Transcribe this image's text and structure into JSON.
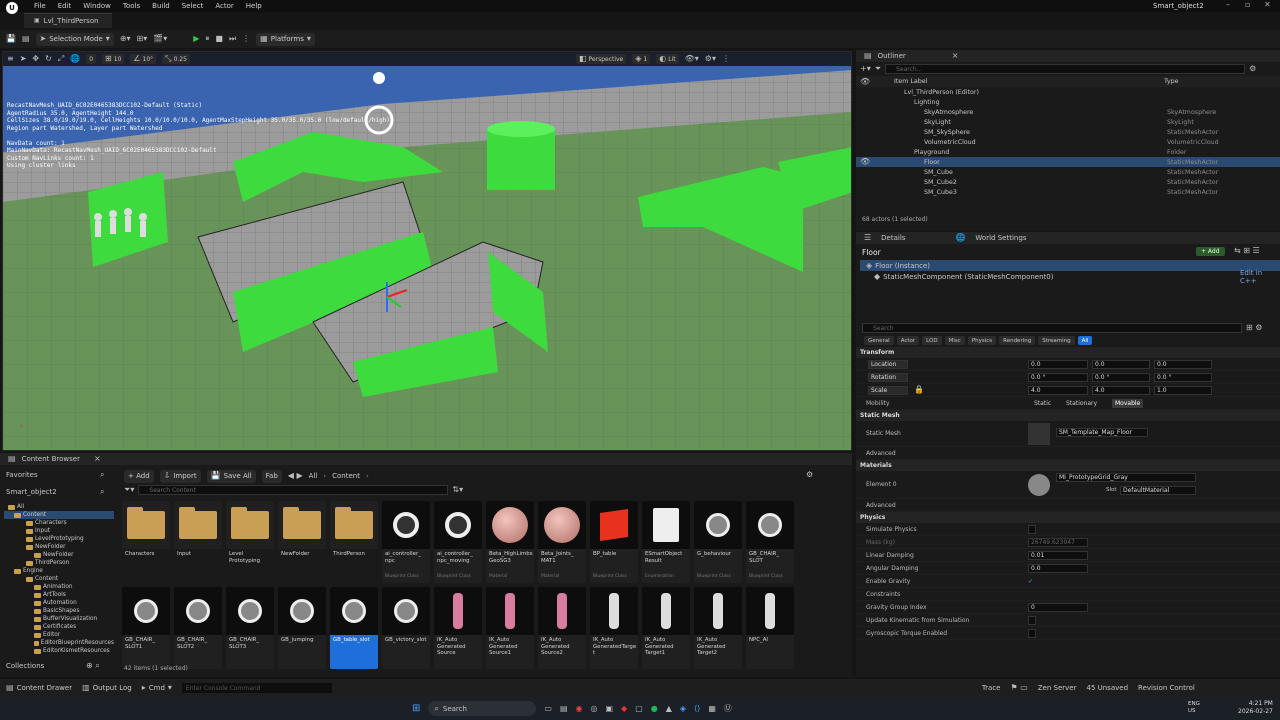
{
  "app": {
    "menus": [
      "File",
      "Edit",
      "Window",
      "Tools",
      "Build",
      "Select",
      "Actor",
      "Help"
    ],
    "project": "Smart_object2",
    "level_tab": "Lvl_ThirdPerson"
  },
  "toolbar": {
    "selection_mode": "Selection Mode",
    "platforms": "Platforms"
  },
  "viewport": {
    "perspective": "Perspective",
    "lit": "Lit",
    "grid_snap": "10",
    "rot_snap": "10°",
    "scale_snap": "0.25",
    "cam_speed": "1",
    "snap0": "0",
    "nav_text": "RecastNavMesh_UAID_6C02E0465383DCC102-Default (Static)\nAgentRadius 35.0, AgentHeight 144.0\nCellSizes 38.0/19.0/19.0, CellHeights 10.0/10.0/10.0, AgentMaxStepHeight 35.0/35.0/35.0 (low/default/high)\nRegion part Watershed, Layer part Watershed\n\nNavData count: 1\nMainNavData: RecastNavMesh_UAID_6C02E0465383DCC102-Default\nCustom NavLinks count: 1\nUsing cluster links"
  },
  "outliner": {
    "title": "Outliner",
    "search_placeholder": "Search...",
    "col_label": "Item Label",
    "col_type": "Type",
    "status": "68 actors (1 selected)",
    "rows": [
      {
        "label": "Lvl_ThirdPerson (Editor)",
        "type": "",
        "indent": 48
      },
      {
        "label": "Lighting",
        "type": "",
        "indent": 58
      },
      {
        "label": "SkyAtmosphere",
        "type": "SkyAtmosphere",
        "indent": 68
      },
      {
        "label": "SkyLight",
        "type": "SkyLight",
        "indent": 68
      },
      {
        "label": "SM_SkySphere",
        "type": "StaticMeshActor",
        "indent": 68
      },
      {
        "label": "VolumetricCloud",
        "type": "VolumetricCloud",
        "indent": 68
      },
      {
        "label": "Playground",
        "type": "Folder",
        "indent": 58
      },
      {
        "label": "Floor",
        "type": "StaticMeshActor",
        "indent": 68
      },
      {
        "label": "SM_Cube",
        "type": "StaticMeshActor",
        "indent": 68
      },
      {
        "label": "SM_Cube2",
        "type": "StaticMeshActor",
        "indent": 68
      },
      {
        "label": "SM_Cube3",
        "type": "StaticMeshActor",
        "indent": 68
      }
    ]
  },
  "details": {
    "tab1": "Details",
    "tab2": "World Settings",
    "actor": "Floor",
    "add": "+ Add",
    "instance": "Floor (Instance)",
    "component": "StaticMeshComponent (StaticMeshComponent0)",
    "edit_cpp": "Edit in C++",
    "search_placeholder": "Search",
    "filters": [
      "General",
      "Actor",
      "LOD",
      "Misc",
      "Physics",
      "Rendering",
      "Streaming",
      "All"
    ],
    "transform": "Transform",
    "location": "Location",
    "rotation": "Rotation",
    "scale": "Scale",
    "loc": [
      "0.0",
      "0.0",
      "0.0"
    ],
    "rot": [
      "0.0 °",
      "0.0 °",
      "0.0 °"
    ],
    "scl": [
      "4.0",
      "4.0",
      "1.0"
    ],
    "mobility": "Mobility",
    "mob_opts": [
      "Static",
      "Stationary",
      "Movable"
    ],
    "static_mesh_sect": "Static Mesh",
    "static_mesh": "Static Mesh",
    "mesh_value": "SM_Template_Map_Floor",
    "advanced": "Advanced",
    "materials": "Materials",
    "element0": "Element 0",
    "material_value": "MI_PrototypeGrid_Gray",
    "slot": "Slot",
    "slot_value": "DefaultMaterial",
    "physics": "Physics",
    "simulate": "Simulate Physics",
    "mass": "Mass (kg)",
    "mass_value": "26749.623047",
    "lin_damp": "Linear Damping",
    "lin_val": "0.01",
    "ang_damp": "Angular Damping",
    "ang_val": "0.0",
    "gravity": "Enable Gravity",
    "constraints": "Constraints",
    "ggi": "Gravity Group Index",
    "ggi_val": "0",
    "upd": "Update Kinematic from Simulation",
    "gyro": "Gyroscopic Torque Enabled"
  },
  "content_browser": {
    "tab": "Content Browser",
    "favorites": "Favorites",
    "root": "Smart_object2",
    "add": "+ Add",
    "import": "Import",
    "save_all": "Save All",
    "fab": "Fab",
    "path": [
      "All",
      "Content"
    ],
    "search_placeholder": "Search Content",
    "count": "42 items (1 selected)",
    "collections": "Collections",
    "tree": [
      {
        "t": "All",
        "i": 4
      },
      {
        "t": "Content",
        "i": 10
      },
      {
        "t": "Characters",
        "i": 22
      },
      {
        "t": "Input",
        "i": 22
      },
      {
        "t": "LevelPrototyping",
        "i": 22
      },
      {
        "t": "NewFolder",
        "i": 22
      },
      {
        "t": "NewFolder",
        "i": 30
      },
      {
        "t": "ThirdPerson",
        "i": 22
      },
      {
        "t": "Engine",
        "i": 10
      },
      {
        "t": "Content",
        "i": 22
      },
      {
        "t": "Animation",
        "i": 30
      },
      {
        "t": "ArtTools",
        "i": 30
      },
      {
        "t": "Automation",
        "i": 30
      },
      {
        "t": "BasicShapes",
        "i": 30
      },
      {
        "t": "BufferVisualization",
        "i": 30
      },
      {
        "t": "Certificates",
        "i": 30
      },
      {
        "t": "Editor",
        "i": 30
      },
      {
        "t": "EditorBlueprintResources",
        "i": 30
      },
      {
        "t": "EditorKismetResources",
        "i": 30
      }
    ],
    "assets1": [
      {
        "n": "Characters",
        "k": "folder",
        "ty": ""
      },
      {
        "n": "Input",
        "k": "folder",
        "ty": ""
      },
      {
        "n": "Level Prototyping",
        "k": "folder",
        "ty": ""
      },
      {
        "n": "NewFolder",
        "k": "folder",
        "ty": ""
      },
      {
        "n": "ThirdPerson",
        "k": "folder",
        "ty": ""
      },
      {
        "n": "ai_controller_ npc",
        "k": "ctrl",
        "ty": "Blueprint Class"
      },
      {
        "n": "ai_controller_ npc_moving",
        "k": "ctrl",
        "ty": "Blueprint Class"
      },
      {
        "n": "Beta_HighLimbs GeoSG3",
        "k": "sphere",
        "ty": "Material"
      },
      {
        "n": "Beta_Joints_ MAT1",
        "k": "sphere",
        "ty": "Material"
      },
      {
        "n": "BP_table",
        "k": "redcube",
        "ty": "Blueprint Class"
      },
      {
        "n": "ESmartObject Result",
        "k": "doc",
        "ty": "Enumeration"
      },
      {
        "n": "G_behaviour",
        "k": "cube",
        "ty": "Blueprint Class"
      },
      {
        "n": "GB_CHAIR_ SLOT",
        "k": "cube",
        "ty": "Blueprint Class"
      }
    ],
    "assets2": [
      {
        "n": "GB_CHAIR_ SLOT1",
        "k": "cube",
        "ty": ""
      },
      {
        "n": "GB_CHAIR_ SLOT2",
        "k": "cube",
        "ty": ""
      },
      {
        "n": "GB_CHAIR_ SLOT3",
        "k": "cube",
        "ty": ""
      },
      {
        "n": "GB_jumping",
        "k": "cube",
        "ty": ""
      },
      {
        "n": "GB_table_slot",
        "k": "cube",
        "ty": "",
        "sel": true
      },
      {
        "n": "GB_victory_slot",
        "k": "cube",
        "ty": ""
      },
      {
        "n": "IK_Auto Generated Source",
        "k": "pink",
        "ty": ""
      },
      {
        "n": "IK_Auto Generated Source1",
        "k": "pink",
        "ty": ""
      },
      {
        "n": "IK_Auto Generated Source2",
        "k": "pink",
        "ty": ""
      },
      {
        "n": "IK_Auto GeneratedTarget",
        "k": "white",
        "ty": ""
      },
      {
        "n": "IK_Auto Generated Target1",
        "k": "white",
        "ty": ""
      },
      {
        "n": "IK_Auto Generated Target2",
        "k": "white",
        "ty": ""
      },
      {
        "n": "NPC_AI",
        "k": "white",
        "ty": ""
      }
    ]
  },
  "status": {
    "drawer": "Content Drawer",
    "output": "Output Log",
    "cmd": "Cmd",
    "console_placeholder": "Enter Console Command",
    "trace": "Trace",
    "zen": "Zen Server",
    "unsaved": "45 Unsaved",
    "revision": "Revision Control"
  },
  "taskbar": {
    "search": "Search",
    "lang1": "ENG",
    "lang2": "US",
    "time": "4:21 PM",
    "date": "2026-02-27"
  }
}
